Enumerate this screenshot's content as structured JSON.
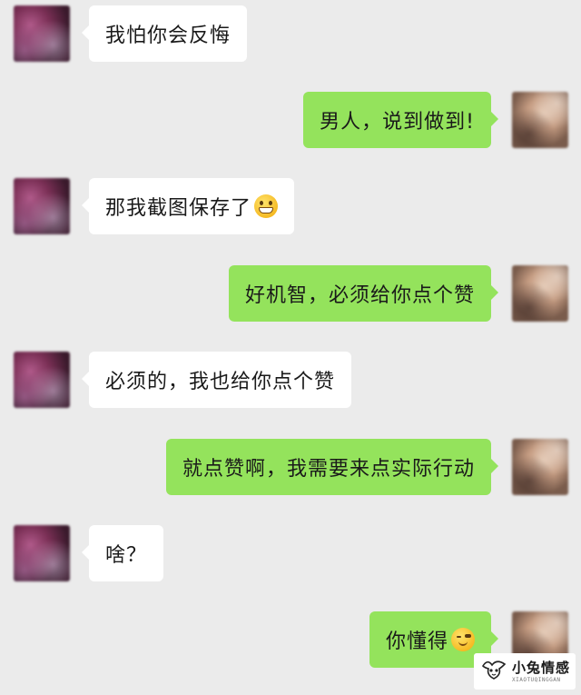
{
  "messages": [
    {
      "side": "left",
      "text": "我怕你会反悔",
      "emoji": ""
    },
    {
      "side": "right",
      "text": "男人，说到做到!",
      "emoji": ""
    },
    {
      "side": "left",
      "text": "那我截图保存了",
      "emoji": "grinning-face-emoji"
    },
    {
      "side": "right",
      "text": "好机智，必须给你点个赞",
      "emoji": ""
    },
    {
      "side": "left",
      "text": "必须的，我也给你点个赞",
      "emoji": ""
    },
    {
      "side": "right",
      "text": "就点赞啊，我需要来点实际行动",
      "emoji": ""
    },
    {
      "side": "left",
      "text": "啥？",
      "emoji": ""
    },
    {
      "side": "right",
      "text": "你懂得",
      "emoji": "winking-face-emoji"
    }
  ],
  "watermark": {
    "title": "小兔情感",
    "subtitle": "XIAOTUQINGGAN"
  },
  "colors": {
    "background": "#ebebeb",
    "sent_bubble": "#94e35c",
    "received_bubble": "#ffffff"
  }
}
